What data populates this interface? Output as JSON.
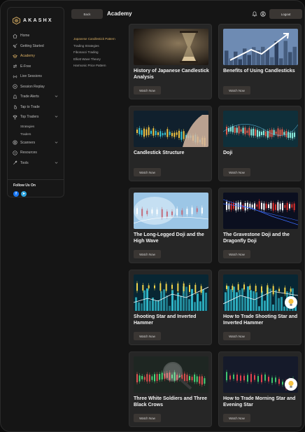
{
  "brand": {
    "name": "AKASHX"
  },
  "sidebar": {
    "items": [
      {
        "label": "Home",
        "icon": "home-icon"
      },
      {
        "label": "Getting Started",
        "icon": "rocket-icon"
      },
      {
        "label": "Academy",
        "icon": "graduation-cap-icon",
        "active": true
      },
      {
        "label": "E-Free",
        "icon": "exchange-icon"
      },
      {
        "label": "Live Sessions",
        "icon": "broadcast-icon"
      },
      {
        "label": "Session Replay",
        "icon": "play-circle-icon"
      },
      {
        "label": "Trade Alerts",
        "icon": "bell-icon",
        "chevron": true
      },
      {
        "label": "Tap to Trade",
        "icon": "tap-icon"
      },
      {
        "label": "Top Traders",
        "icon": "trophy-icon",
        "chevron": true
      }
    ],
    "sub_items": [
      {
        "label": "Strategies"
      },
      {
        "label": "Traders"
      }
    ],
    "items_after": [
      {
        "label": "Scanners",
        "icon": "scanner-icon",
        "chevron": true
      },
      {
        "label": "Resources",
        "icon": "resources-icon"
      },
      {
        "label": "Tools",
        "icon": "tools-icon",
        "chevron": true
      }
    ],
    "follow_title": "Follow Us On",
    "social": {
      "facebook": "f",
      "telegram": "➤"
    }
  },
  "topbar": {
    "back_label": "Back",
    "title": "Academy",
    "logout_label": "Logout"
  },
  "topics": [
    {
      "label": "Japanese Candlestick Pattern",
      "active": true
    },
    {
      "label": "Trading Strategies"
    },
    {
      "label": "Fibonacci Trading"
    },
    {
      "label": "Elliott Wave Theory"
    },
    {
      "label": "Harmonic Price Pattern"
    }
  ],
  "cards": [
    {
      "title": "History of Japanese Candlestick Analysis",
      "button": "Watch Now",
      "thumb": "hourglass"
    },
    {
      "title": "Benefits of Using Candlesticks",
      "button": "Watch Now",
      "thumb": "city-arrow"
    },
    {
      "title": "Candlestick Structure",
      "button": "Watch Now",
      "thumb": "candles-hand"
    },
    {
      "title": "Doji",
      "button": "Watch Now",
      "thumb": "teal-chart"
    },
    {
      "title": "The Long-Legged Doji and the High Wave",
      "button": "Watch Now",
      "thumb": "blue-map"
    },
    {
      "title": "The Gravestone Doji and the Dragonfly Doji",
      "button": "Watch Now",
      "thumb": "red-blue-chart"
    },
    {
      "title": "Shooting Star and Inverted Hammer",
      "button": "Watch Now",
      "thumb": "teal-bars"
    },
    {
      "title": "How to Trade Shooting Star and Inverted Hammer",
      "button": "Watch Now",
      "thumb": "teal-bars-bulb"
    },
    {
      "title": "Three White Soldiers and Three Black Crows",
      "button": "Watch Now",
      "thumb": "magnifier"
    },
    {
      "title": "How to Trade Morning Star and Evening Star",
      "button": "Watch Now",
      "thumb": "dark-candles-bulb"
    }
  ],
  "colors": {
    "accent": "#d7ad63",
    "card_bg": "#262626",
    "button_bg": "#3a3633"
  }
}
